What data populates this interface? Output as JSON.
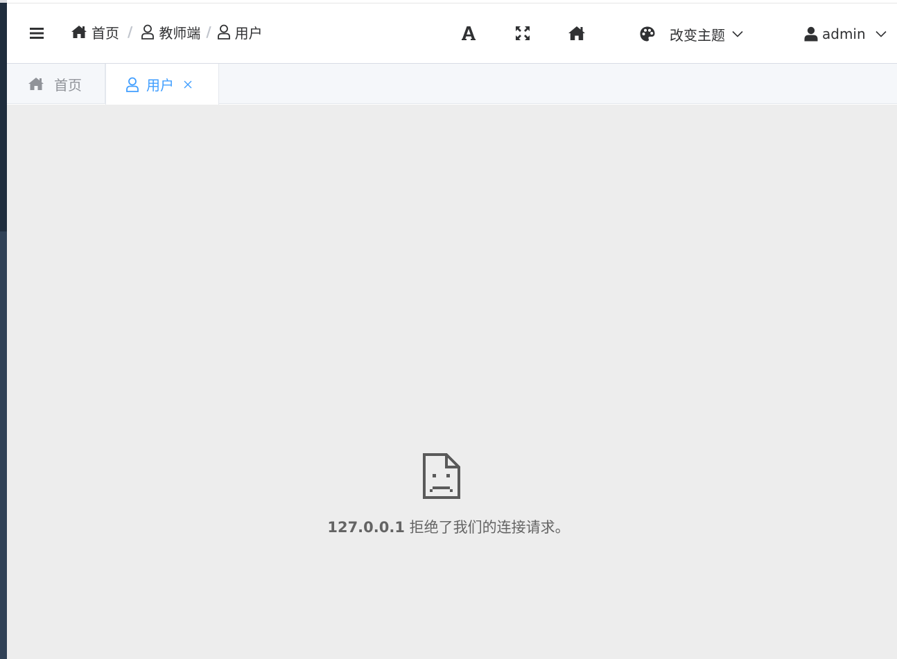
{
  "breadcrumb": {
    "items": [
      {
        "label": "首页",
        "icon": "home-icon"
      },
      {
        "label": "教师端",
        "icon": "user-outline-icon"
      },
      {
        "label": "用户",
        "icon": "user-outline-icon"
      }
    ],
    "separator": "/"
  },
  "navbar": {
    "font_size_icon": "font-size-icon",
    "fullscreen_icon": "fullscreen-icon",
    "home_icon": "home-icon",
    "theme_label": "改变主题",
    "user_name": "admin"
  },
  "tags": [
    {
      "label": "首页",
      "icon": "home-icon",
      "active": false
    },
    {
      "label": "用户",
      "icon": "user-outline-icon",
      "active": true,
      "closable": true
    }
  ],
  "error": {
    "host": "127.0.0.1",
    "message": "拒绝了我们的连接请求。"
  },
  "colors": {
    "active_tag": "#409eff",
    "sidebar": "#304156",
    "content_bg": "#ededed",
    "text": "#303133"
  }
}
